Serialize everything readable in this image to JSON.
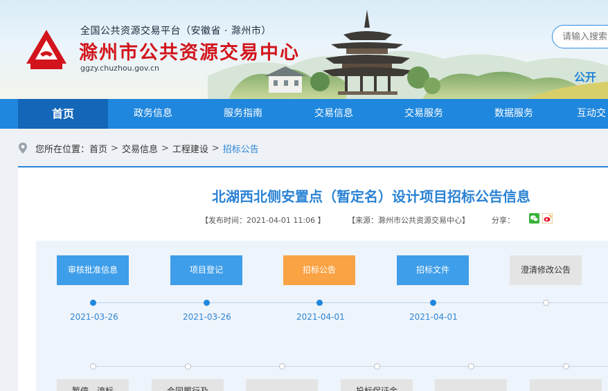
{
  "header": {
    "portal_line": "全国公共资源交易平台（安徽省 · 滁州市）",
    "center_name": "滁州市公共资源交易中心",
    "domain": "ggzy.chuzhou.gov.cn",
    "search_placeholder": "请输入搜索",
    "right_tag": "公开"
  },
  "nav": {
    "items": [
      {
        "label": "首页",
        "active": true
      },
      {
        "label": "政务信息"
      },
      {
        "label": "服务指南"
      },
      {
        "label": "交易信息"
      },
      {
        "label": "交易服务"
      },
      {
        "label": "数据服务"
      },
      {
        "label": "互动交"
      }
    ]
  },
  "breadcrumb": {
    "prefix": "您所在位置：",
    "items": [
      "首页",
      "交易信息",
      "工程建设",
      "招标公告"
    ],
    "separator": ">"
  },
  "article": {
    "title": "北湖西北侧安置点（暂定名）设计项目招标公告信息",
    "publish_time": "【发布时间：2021-04-01 11:06 】",
    "source": "【来源：滁州市公共资源交易中心】",
    "share_label": "分享："
  },
  "timeline": {
    "steps": [
      {
        "label": "审核批准信息",
        "date": "2021-03-26",
        "state": "done"
      },
      {
        "label": "项目登记",
        "date": "2021-03-26",
        "state": "done"
      },
      {
        "label": "招标公告",
        "date": "2021-04-01",
        "state": "current"
      },
      {
        "label": "招标文件",
        "date": "2021-04-01",
        "state": "done"
      },
      {
        "label": "澄清修改公告",
        "date": "",
        "state": "inactive"
      }
    ],
    "row2": [
      "暂停、流标",
      "合同履行及",
      "",
      "投标保证金",
      "",
      ""
    ]
  },
  "colors": {
    "nav_blue": "#1f87dd",
    "nav_active": "#1466b9",
    "brand_red": "#d2151c",
    "title_blue": "#2a82d4",
    "step_blue": "#3f9ee9",
    "step_orange": "#f9a344"
  }
}
